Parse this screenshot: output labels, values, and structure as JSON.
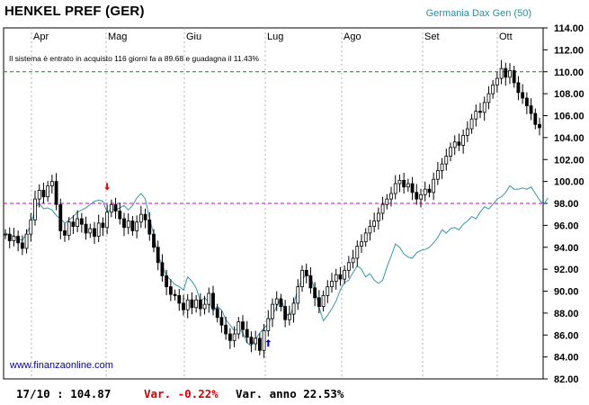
{
  "header": {
    "title": "HENKEL PREF (GER)",
    "index_label": "Germania Dax Gen (50)"
  },
  "annotation": "Il sistema è entrato in acquisto 116 giorni fa a 89.68  e guadagna il 11.43%",
  "source": "www.finanzaonline.com",
  "footer": {
    "date_price": "17/10 : 104.87",
    "var_day": "Var. -0.22%",
    "var_year": "Var. anno 22.53%"
  },
  "colors": {
    "price": "#000000",
    "index_line": "#3a96a8",
    "resistance": "#009900",
    "support": "#cc00cc",
    "sell_arrow": "#dd0000",
    "buy_arrow": "#0000dd"
  },
  "chart_data": {
    "type": "line",
    "title": "HENKEL PREF (GER)",
    "ylim": [
      82,
      114
    ],
    "yticks": [
      "114.00",
      "112.00",
      "110.00",
      "108.00",
      "106.00",
      "104.00",
      "102.00",
      "100.00",
      "98.00",
      "96.00",
      "94.00",
      "92.00",
      "90.00",
      "88.00",
      "86.00",
      "84.00",
      "82.00"
    ],
    "months": [
      "Apr",
      "Mag",
      "Giu",
      "Lug",
      "Ago",
      "Set",
      "Ott"
    ],
    "hlines": [
      {
        "name": "resistance",
        "value": 110.0
      },
      {
        "name": "support",
        "value": 98.0
      }
    ],
    "series": [
      {
        "name": "HENKEL PREF (GER)",
        "values": [
          95.2,
          94.6,
          95.0,
          94.4,
          93.9,
          95.2,
          96.5,
          98.4,
          99.2,
          98.6,
          99.6,
          100.0,
          97.9,
          95.5,
          95.1,
          96.3,
          95.9,
          96.6,
          96.1,
          95.3,
          95.7,
          95.0,
          96.2,
          95.8,
          97.2,
          97.9,
          97.3,
          96.6,
          95.8,
          96.4,
          95.5,
          96.3,
          97.0,
          96.5,
          95.2,
          94.0,
          92.6,
          91.4,
          90.4,
          89.7,
          89.6,
          88.9,
          88.3,
          89.2,
          88.5,
          89.2,
          88.4,
          88.8,
          89.8,
          88.4,
          87.6,
          86.9,
          86.1,
          85.5,
          86.1,
          87.2,
          86.5,
          85.8,
          85.2,
          85.7,
          84.6,
          86.4,
          87.5,
          88.8,
          89.3,
          88.6,
          87.4,
          87.9,
          88.9,
          90.4,
          91.9,
          91.4,
          90.3,
          89.4,
          88.6,
          89.6,
          90.4,
          90.9,
          91.5,
          91.1,
          91.9,
          92.6,
          93.0,
          94.1,
          94.5,
          95.3,
          95.9,
          96.4,
          97.1,
          97.9,
          98.4,
          98.9,
          99.8,
          100.1,
          99.5,
          99.8,
          99.0,
          98.4,
          98.8,
          99.3,
          99.0,
          100.2,
          101.0,
          101.6,
          102.3,
          103.1,
          103.6,
          103.3,
          104.2,
          104.8,
          105.7,
          106.4,
          106.3,
          107.2,
          108.0,
          108.8,
          109.4,
          110.3,
          109.5,
          110.1,
          109.0,
          108.1,
          107.6,
          106.9,
          106.2,
          105.2,
          104.9
        ]
      },
      {
        "name": "Germania Dax Gen (50)",
        "values": [
          95.3,
          95.1,
          95.0,
          94.8,
          94.6,
          95.3,
          96.0,
          97.6,
          98.0,
          97.5,
          97.6,
          97.4,
          96.9,
          96.6,
          96.2,
          96.5,
          96.8,
          97.2,
          97.4,
          97.6,
          97.9,
          98.2,
          98.3,
          98.2,
          97.2,
          97.5,
          97.4,
          97.6,
          97.8,
          97.4,
          97.8,
          98.5,
          98.9,
          98.4,
          96.6,
          95.2,
          93.2,
          92.4,
          91.4,
          91.0,
          90.6,
          90.4,
          90.1,
          91.3,
          90.9,
          90.3,
          89.1,
          89.4,
          89.0,
          88.2,
          88.6,
          88.3,
          87.4,
          86.9,
          86.4,
          86.6,
          86.2,
          85.3,
          85.0,
          85.6,
          86.2,
          86.6,
          87.0,
          87.8,
          88.6,
          89.4,
          88.1,
          87.6,
          88.7,
          90.3,
          91.0,
          91.6,
          91.3,
          90.2,
          88.5,
          87.3,
          87.8,
          88.4,
          89.1,
          90.1,
          90.8,
          91.0,
          91.7,
          92.3,
          92.0,
          91.3,
          91.6,
          91.0,
          90.7,
          91.0,
          92.2,
          93.2,
          94.3,
          94.0,
          93.4,
          93.1,
          93.0,
          93.5,
          93.7,
          93.8,
          94.0,
          94.4,
          94.9,
          95.6,
          95.3,
          95.7,
          95.8,
          95.6,
          96.1,
          96.4,
          96.8,
          96.6,
          97.2,
          97.7,
          97.5,
          97.9,
          98.4,
          98.6,
          99.0,
          99.6,
          99.3,
          99.3,
          99.4,
          99.3,
          99.5,
          98.9,
          98.3,
          97.9,
          98.5
        ]
      }
    ]
  }
}
